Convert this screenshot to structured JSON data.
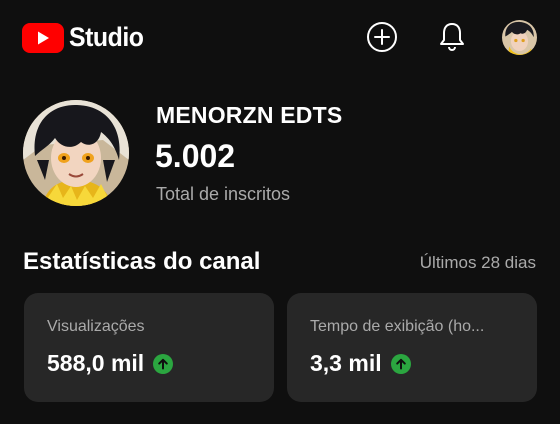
{
  "header": {
    "logo_text": "Studio",
    "icons": [
      "create-icon",
      "notifications-bell-icon",
      "account-avatar"
    ]
  },
  "channel": {
    "name": "MENORZN EDTS",
    "subscriber_count": "5.002",
    "subscriber_label": "Total de inscritos"
  },
  "stats": {
    "title": "Estatísticas do canal",
    "period": "Últimos 28 dias",
    "cards": [
      {
        "label": "Visualizações",
        "value": "588,0 mil",
        "trend": "up"
      },
      {
        "label": "Tempo de exibição (ho...",
        "value": "3,3 mil",
        "trend": "up"
      }
    ]
  },
  "colors": {
    "background": "#0f0f0f",
    "card": "#272727",
    "brand_red": "#ff0000",
    "trend_up": "#2ba640",
    "secondary_text": "#aaaaaa"
  }
}
